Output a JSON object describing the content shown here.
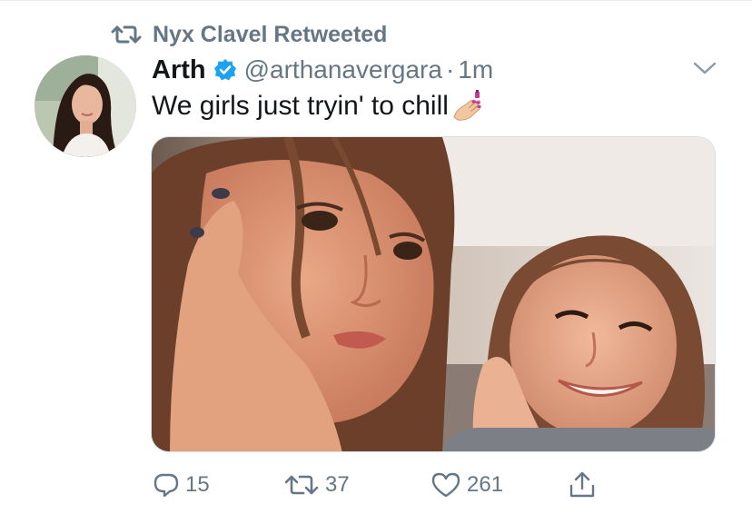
{
  "retweet_banner": {
    "text": "Nyx Clavel Retweeted",
    "icon": "retweet-icon"
  },
  "author": {
    "name": "Arth",
    "verified": true,
    "handle": "@arthanavergara",
    "separator": "·",
    "time": "1m"
  },
  "tweet": {
    "text": "We girls just tryin' to chill",
    "emoji": "nail-polish-emoji"
  },
  "media": {
    "type": "photo"
  },
  "actions": {
    "reply_count": "15",
    "retweet_count": "37",
    "like_count": "261"
  },
  "colors": {
    "text_primary": "#14171a",
    "text_secondary": "#657786",
    "verified_blue": "#1da1f2",
    "divider": "#e6ecf0"
  }
}
